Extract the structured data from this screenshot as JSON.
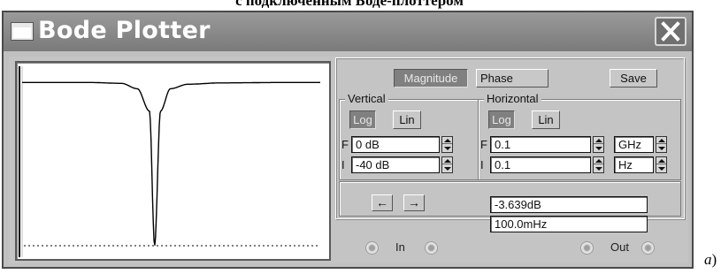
{
  "caption": "с подключенным Боде-плоттером",
  "figure_label": "а",
  "figure_label_paren": ")",
  "window": {
    "title": "Bode Plotter"
  },
  "mode": {
    "magnitude_label": "Magnitude",
    "phase_label": "Phase",
    "selected": "Magnitude"
  },
  "save_label": "Save",
  "vertical": {
    "legend": "Vertical",
    "log_label": "Log",
    "lin_label": "Lin",
    "selected_scale": "Log",
    "final_label": "F",
    "final_value": "0 dB",
    "initial_label": "I",
    "initial_value": "-40 dB"
  },
  "horizontal": {
    "legend": "Horizontal",
    "log_label": "Log",
    "lin_label": "Lin",
    "selected_scale": "Log",
    "final_label": "F",
    "final_value": "0.1",
    "final_unit": "GHz",
    "initial_label": "I",
    "initial_value": "0.1",
    "initial_unit": "Hz"
  },
  "readout": {
    "left_arrow": "←",
    "right_arrow": "→",
    "magnitude_value": "-3.639dB",
    "frequency_value": "100.0mHz"
  },
  "terminals": {
    "in_label": "In",
    "out_label": "Out"
  },
  "colors": {
    "window_bg": "#c0c0c0",
    "titlebar": "#8a8a8a",
    "active_button": "#808080",
    "plot_bg": "#ffffff",
    "trace": "#000000"
  },
  "chart_data": {
    "type": "line",
    "title": "",
    "xlabel": "",
    "ylabel": "",
    "x_scale": "log",
    "xlim": [
      0.1,
      100000000
    ],
    "ylim": [
      -40,
      0
    ],
    "x": [
      0.1,
      10,
      100,
      300,
      700,
      1000,
      1500,
      3000,
      10000,
      100000,
      10000000,
      100000000
    ],
    "series": [
      {
        "values": [
          -3.6,
          -3.6,
          -3.8,
          -5,
          -10,
          -40,
          -10,
          -5,
          -4,
          -3.7,
          -3.6,
          -3.6
        ]
      }
    ],
    "cursor": {
      "x": 0.1,
      "y": -3.639
    }
  }
}
